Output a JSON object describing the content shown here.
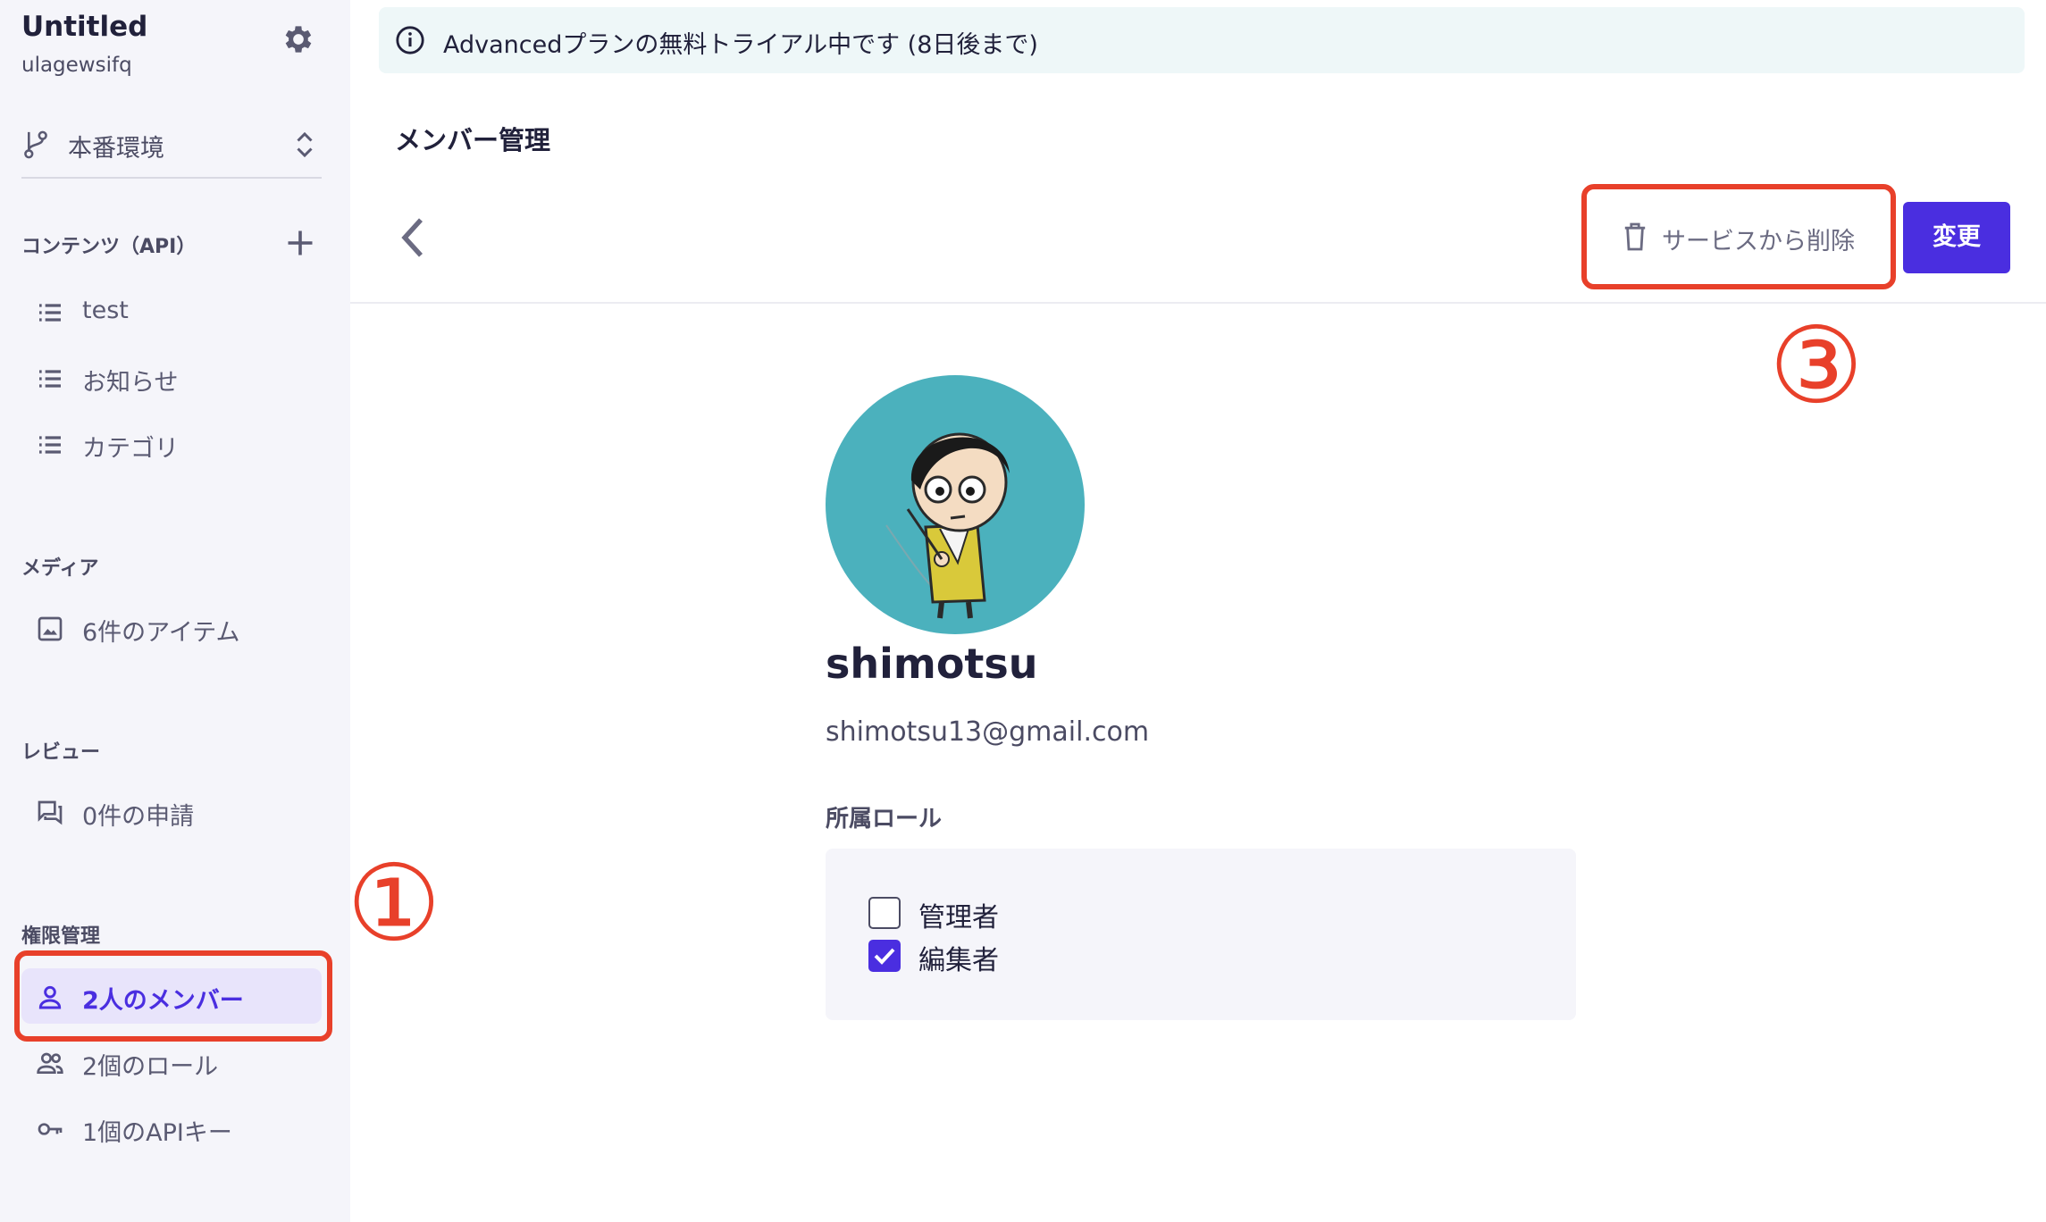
{
  "sidebar": {
    "title": "Untitled",
    "subtitle": "ulagewsifq",
    "environment": "本番環境",
    "contents_section": "コンテンツ（API）",
    "contents_items": [
      {
        "label": "test",
        "icon": "list-icon"
      },
      {
        "label": "お知らせ",
        "icon": "list-icon"
      },
      {
        "label": "カテゴリ",
        "icon": "list-icon"
      }
    ],
    "media_section": "メディア",
    "media_item": "6件のアイテム",
    "review_section": "レビュー",
    "review_item": "0件の申請",
    "permissions_section": "権限管理",
    "members_item": "2人のメンバー",
    "roles_item": "2個のロール",
    "apikeys_item": "1個のAPIキー"
  },
  "banner": {
    "text": "Advancedプランの無料トライアル中です (8日後まで)"
  },
  "page": {
    "title": "メンバー管理"
  },
  "toolbar": {
    "delete_label": "サービスから削除",
    "change_label": "変更"
  },
  "member": {
    "name": "shimotsu",
    "email": "shimotsu13@gmail.com"
  },
  "roles": {
    "title": "所属ロール",
    "items": [
      {
        "label": "管理者",
        "checked": false
      },
      {
        "label": "編集者",
        "checked": true
      }
    ]
  },
  "annotations": {
    "one": "①",
    "three": "③"
  },
  "colors": {
    "accent": "#4a2ee0",
    "annotation": "#e8402a",
    "avatar_bg": "#4bb1bd",
    "sidebar_bg": "#f5f5fa",
    "banner_bg": "#eef7f8"
  }
}
